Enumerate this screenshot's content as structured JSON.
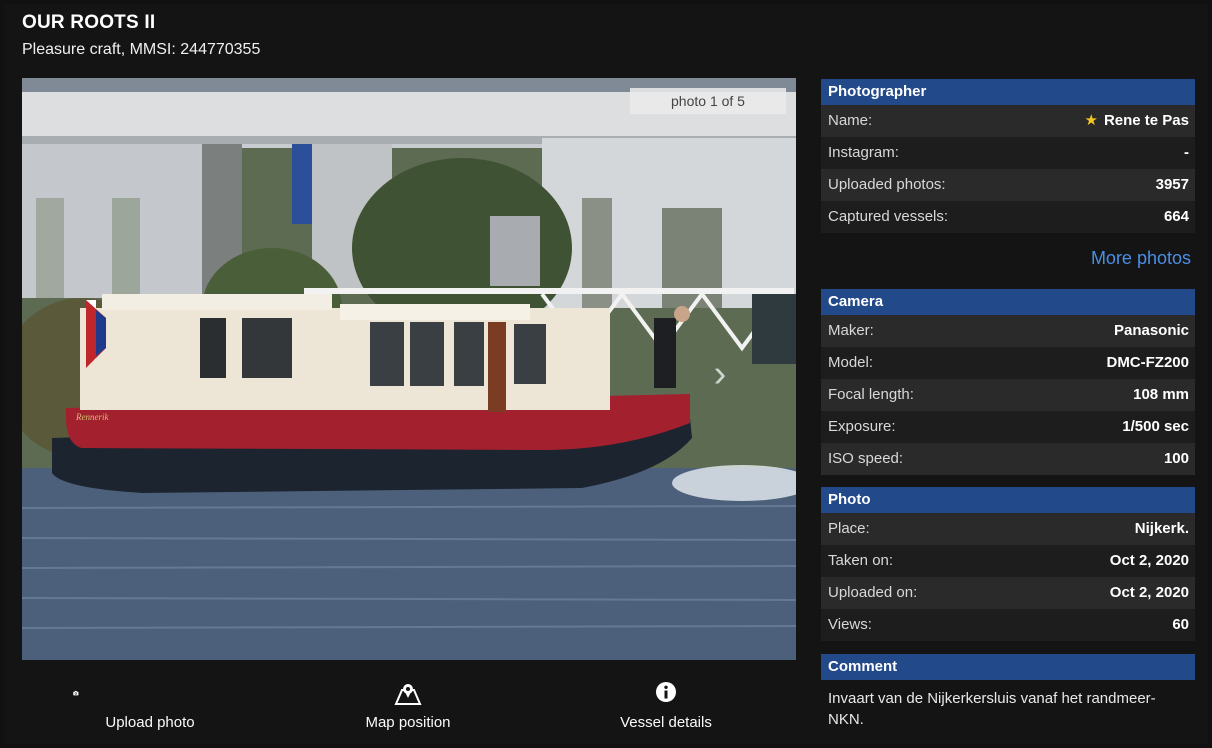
{
  "vessel": {
    "name": "OUR ROOTS II",
    "subtitle": "Pleasure craft, MMSI: 244770355"
  },
  "photo": {
    "counter": "photo 1 of 5",
    "boat_name_on_hull": "Rennerik"
  },
  "actions": [
    {
      "label": "Upload photo",
      "icon": "camera-icon"
    },
    {
      "label": "Map position",
      "icon": "map-icon"
    },
    {
      "label": "Vessel details",
      "icon": "info-icon"
    }
  ],
  "photographer": {
    "heading": "Photographer",
    "rows": [
      {
        "key": "Name:",
        "value": "Rene te Pas"
      },
      {
        "key": "Instagram:",
        "value": "-"
      },
      {
        "key": "Uploaded photos:",
        "value": "3957"
      },
      {
        "key": "Captured vessels:",
        "value": "664"
      }
    ],
    "more_photos": "More photos"
  },
  "camera": {
    "heading": "Camera",
    "rows": [
      {
        "key": "Maker:",
        "value": "Panasonic"
      },
      {
        "key": "Model:",
        "value": "DMC-FZ200"
      },
      {
        "key": "Focal length:",
        "value": "108 mm"
      },
      {
        "key": "Exposure:",
        "value": "1/500 sec"
      },
      {
        "key": "ISO speed:",
        "value": "100"
      }
    ]
  },
  "photo_info": {
    "heading": "Photo",
    "rows": [
      {
        "key": "Place:",
        "value": "Nijkerk."
      },
      {
        "key": "Taken on:",
        "value": "Oct 2, 2020"
      },
      {
        "key": "Uploaded on:",
        "value": "Oct 2, 2020"
      },
      {
        "key": "Views:",
        "value": "60"
      }
    ]
  },
  "comment": {
    "heading": "Comment",
    "text": "Invaart van de Nijkerkersluis vanaf het randmeer-NKN."
  },
  "colors": {
    "panel_header": "#22498a",
    "link": "#4a8fe6",
    "star": "#f3c623",
    "hull_red": "#a3202f"
  }
}
